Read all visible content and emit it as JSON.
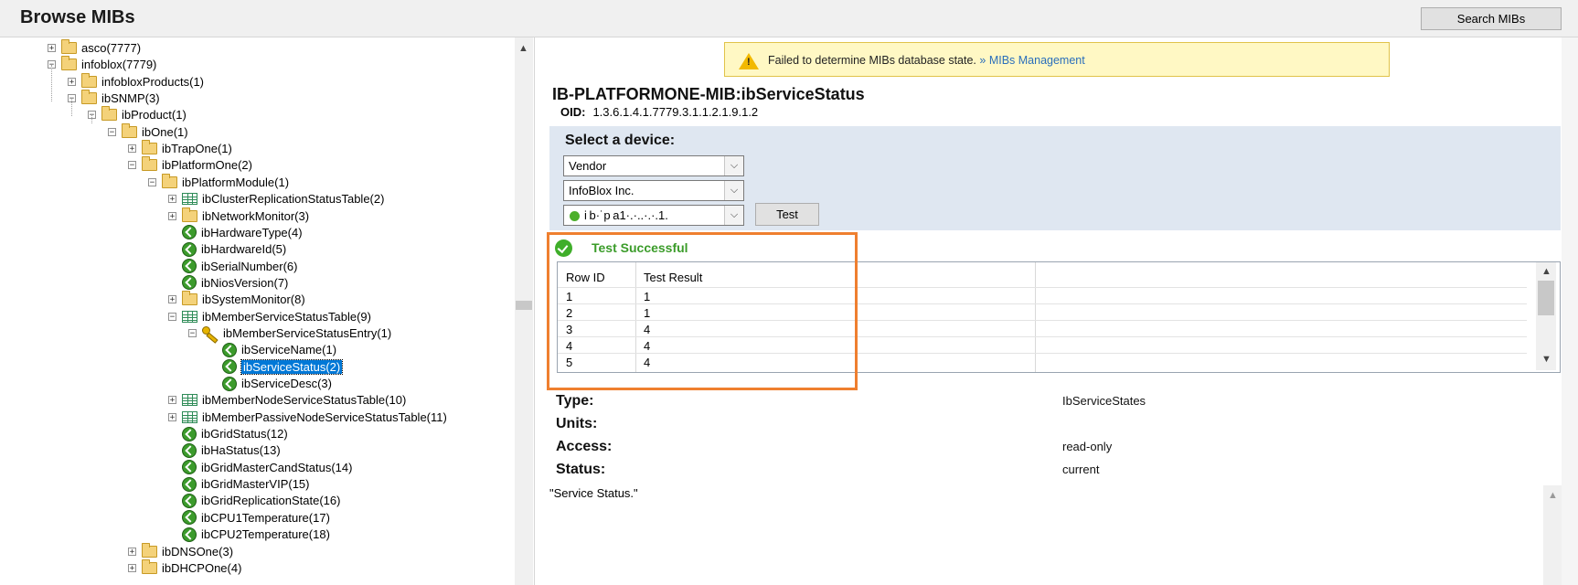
{
  "header": {
    "title": "Browse MIBs",
    "search_button": "Search MIBs"
  },
  "tree": [
    {
      "label": "asco(7777)",
      "depth": 0,
      "exp": "+",
      "icon": "folder"
    },
    {
      "label": "infoblox(7779)",
      "depth": 0,
      "exp": "-",
      "icon": "folder"
    },
    {
      "label": "infobloxProducts(1)",
      "depth": 1,
      "exp": "+",
      "icon": "folder"
    },
    {
      "label": "ibSNMP(3)",
      "depth": 1,
      "exp": "-",
      "icon": "folder"
    },
    {
      "label": "ibProduct(1)",
      "depth": 2,
      "exp": "-",
      "icon": "folder"
    },
    {
      "label": "ibOne(1)",
      "depth": 3,
      "exp": "-",
      "icon": "folder"
    },
    {
      "label": "ibTrapOne(1)",
      "depth": 4,
      "exp": "+",
      "icon": "folder"
    },
    {
      "label": "ibPlatformOne(2)",
      "depth": 4,
      "exp": "-",
      "icon": "folder"
    },
    {
      "label": "ibPlatformModule(1)",
      "depth": 5,
      "exp": "-",
      "icon": "folder"
    },
    {
      "label": "ibClusterReplicationStatusTable(2)",
      "depth": 6,
      "exp": "+",
      "icon": "table"
    },
    {
      "label": "ibNetworkMonitor(3)",
      "depth": 6,
      "exp": "+",
      "icon": "folder"
    },
    {
      "label": "ibHardwareType(4)",
      "depth": 6,
      "exp": "",
      "icon": "leaf"
    },
    {
      "label": "ibHardwareId(5)",
      "depth": 6,
      "exp": "",
      "icon": "leaf"
    },
    {
      "label": "ibSerialNumber(6)",
      "depth": 6,
      "exp": "",
      "icon": "leaf"
    },
    {
      "label": "ibNiosVersion(7)",
      "depth": 6,
      "exp": "",
      "icon": "leaf"
    },
    {
      "label": "ibSystemMonitor(8)",
      "depth": 6,
      "exp": "+",
      "icon": "folder"
    },
    {
      "label": "ibMemberServiceStatusTable(9)",
      "depth": 6,
      "exp": "-",
      "icon": "table"
    },
    {
      "label": "ibMemberServiceStatusEntry(1)",
      "depth": 7,
      "exp": "-",
      "icon": "key"
    },
    {
      "label": "ibServiceName(1)",
      "depth": 8,
      "exp": "",
      "icon": "leaf"
    },
    {
      "label": "ibServiceStatus(2)",
      "depth": 8,
      "exp": "",
      "icon": "leaf",
      "selected": true
    },
    {
      "label": "ibServiceDesc(3)",
      "depth": 8,
      "exp": "",
      "icon": "leaf"
    },
    {
      "label": "ibMemberNodeServiceStatusTable(10)",
      "depth": 6,
      "exp": "+",
      "icon": "table"
    },
    {
      "label": "ibMemberPassiveNodeServiceStatusTable(11)",
      "depth": 6,
      "exp": "+",
      "icon": "table"
    },
    {
      "label": "ibGridStatus(12)",
      "depth": 6,
      "exp": "",
      "icon": "leaf"
    },
    {
      "label": "ibHaStatus(13)",
      "depth": 6,
      "exp": "",
      "icon": "leaf"
    },
    {
      "label": "ibGridMasterCandStatus(14)",
      "depth": 6,
      "exp": "",
      "icon": "leaf"
    },
    {
      "label": "ibGridMasterVIP(15)",
      "depth": 6,
      "exp": "",
      "icon": "leaf"
    },
    {
      "label": "ibGridReplicationState(16)",
      "depth": 6,
      "exp": "",
      "icon": "leaf"
    },
    {
      "label": "ibCPU1Temperature(17)",
      "depth": 6,
      "exp": "",
      "icon": "leaf"
    },
    {
      "label": "ibCPU2Temperature(18)",
      "depth": 6,
      "exp": "",
      "icon": "leaf"
    },
    {
      "label": "ibDNSOne(3)",
      "depth": 4,
      "exp": "+",
      "icon": "folder"
    },
    {
      "label": "ibDHCPOne(4)",
      "depth": 4,
      "exp": "+",
      "icon": "folder"
    }
  ],
  "warning": {
    "text": "Failed to determine MIBs database state.",
    "link": "» MIBs Management"
  },
  "mib": {
    "title": "IB-PLATFORMONE-MIB:ibServiceStatus",
    "oid_label": "OID:",
    "oid_value": "1.3.6.1.4.1.7779.3.1.1.2.1.9.1.2"
  },
  "device": {
    "label": "Select a device:",
    "vendor": "Vendor",
    "manufacturer": "InfoBlox Inc.",
    "host": "i b·˙p a1·.·..·.·.1.",
    "test_button": "Test"
  },
  "result": {
    "status": "Test Successful",
    "headers": [
      "Row ID",
      "Test Result"
    ],
    "rows": [
      [
        "1",
        "1"
      ],
      [
        "2",
        "1"
      ],
      [
        "3",
        "4"
      ],
      [
        "4",
        "4"
      ],
      [
        "5",
        "4"
      ]
    ]
  },
  "props": {
    "type_label": "Type:",
    "type_value": "IbServiceStates",
    "units_label": "Units:",
    "access_label": "Access:",
    "access_value": "read-only",
    "status_label": "Status:",
    "status_value": "current"
  },
  "description": "\"Service Status.\"",
  "colors": {
    "success": "#3b9c2a",
    "highlight": "#ef7f2f",
    "selection": "#0078d7",
    "link": "#2a6ebb"
  }
}
